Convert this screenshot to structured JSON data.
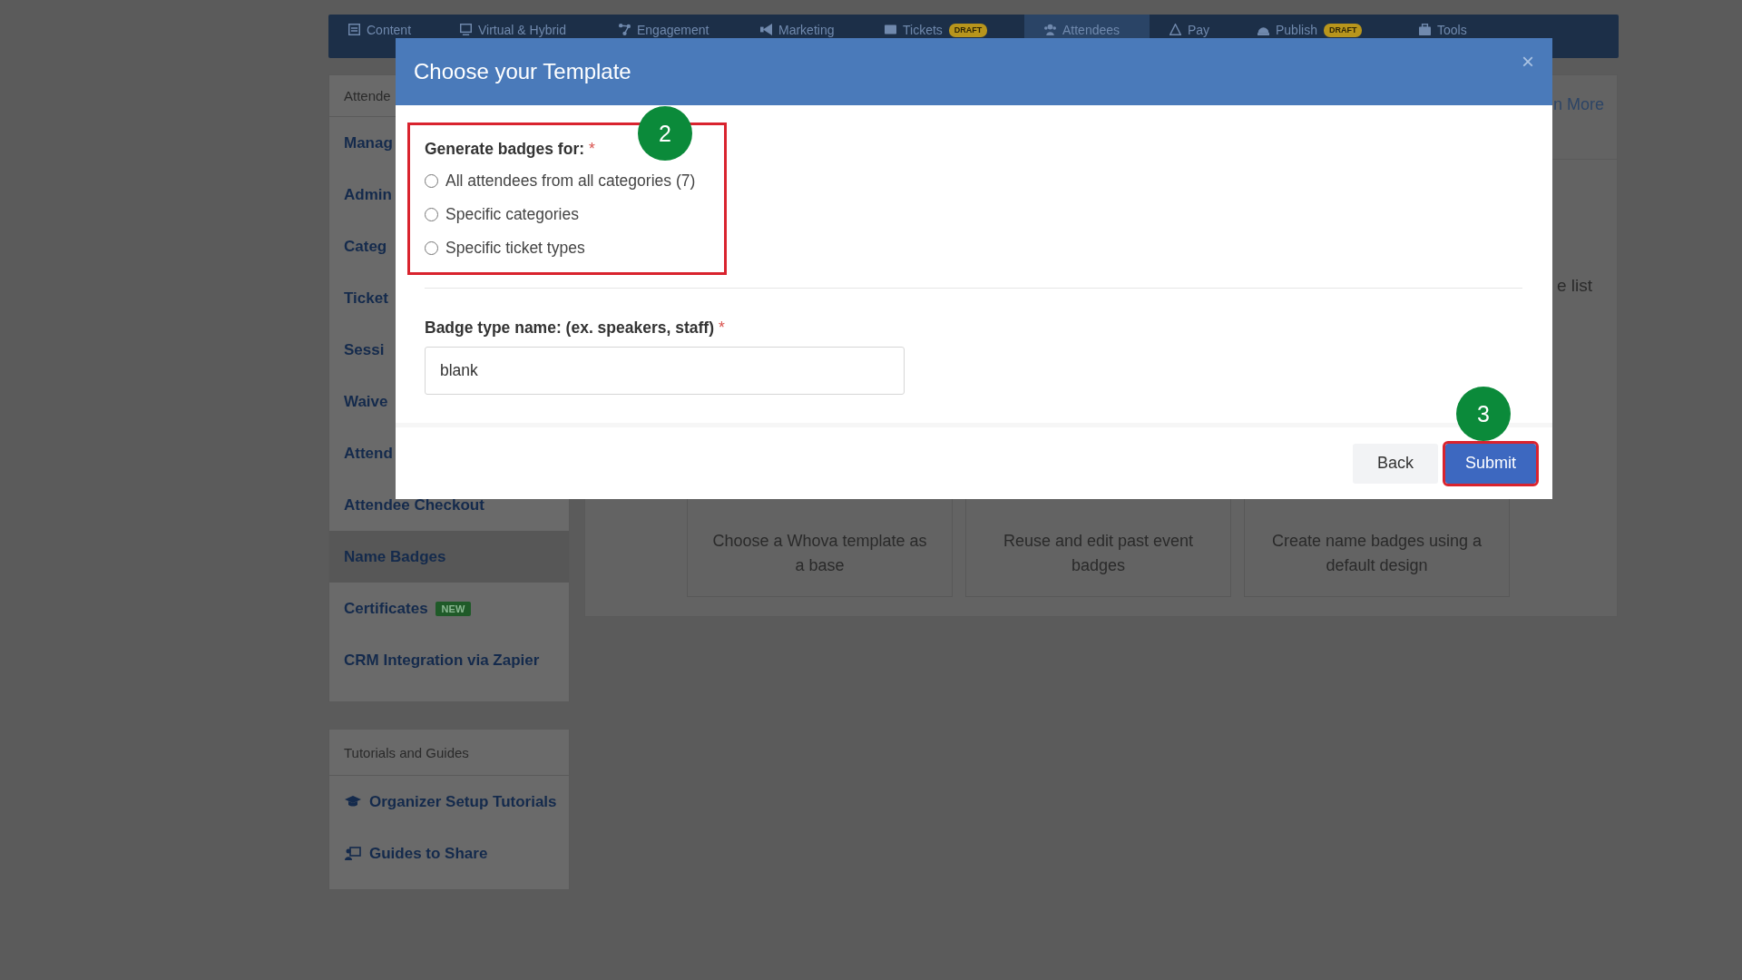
{
  "nav": {
    "tabs": [
      {
        "label": "Content",
        "selected": false
      },
      {
        "label": "Virtual & Hybrid",
        "selected": false
      },
      {
        "label": "Engagement",
        "selected": false
      },
      {
        "label": "Marketing",
        "selected": false
      },
      {
        "label": "Tickets",
        "badge": "DRAFT",
        "selected": false
      },
      {
        "label": "Attendees",
        "selected": true
      },
      {
        "label": "Pay",
        "selected": false
      },
      {
        "label": "Publish",
        "badge": "DRAFT",
        "selected": false
      },
      {
        "label": "Tools",
        "selected": false
      }
    ]
  },
  "sidebar": {
    "sections": [
      {
        "title": "Attende",
        "items": [
          {
            "label": "Manag",
            "selected": false
          },
          {
            "label": "Admin",
            "selected": false
          },
          {
            "label": "Categ",
            "selected": false
          },
          {
            "label": "Ticket",
            "selected": false
          },
          {
            "label": "Sessi",
            "selected": false
          },
          {
            "label": "Waive",
            "selected": false
          },
          {
            "label": "Attend",
            "selected": false
          },
          {
            "label": "Attendee Checkout",
            "selected": false
          },
          {
            "label": "Name Badges",
            "selected": true
          },
          {
            "label": "Certificates",
            "badge": "NEW",
            "selected": false
          },
          {
            "label": "CRM Integration via Zapier",
            "selected": false
          }
        ]
      },
      {
        "title": "Tutorials and Guides",
        "items": [
          {
            "label": "Organizer Setup Tutorials",
            "selected": false
          },
          {
            "label": "Guides to Share",
            "selected": false
          }
        ]
      }
    ]
  },
  "main": {
    "link": "n More",
    "note": "e list",
    "cards": [
      {
        "text": "Choose a Whova template as a base"
      },
      {
        "text": "Reuse and edit past event badges"
      },
      {
        "text": "Create name badges using a default design"
      }
    ]
  },
  "modal": {
    "title": "Choose your Template",
    "close": "×",
    "generate_for": {
      "label": "Generate badges for:",
      "required": "*",
      "highlighted": true,
      "options": [
        {
          "label": "All attendees from all categories (7)",
          "selected": false
        },
        {
          "label": "Specific categories",
          "selected": false
        },
        {
          "label": "Specific ticket types",
          "selected": false
        }
      ]
    },
    "badge_type": {
      "label": "Badge type name: (ex. speakers, staff)",
      "required": "*",
      "value": "blank"
    },
    "buttons": [
      {
        "label": "Back",
        "kind": "secondary",
        "highlighted": false
      },
      {
        "label": "Submit",
        "kind": "primary",
        "highlighted": true
      }
    ],
    "step_markers": [
      {
        "label": "2"
      },
      {
        "label": "3"
      }
    ]
  }
}
